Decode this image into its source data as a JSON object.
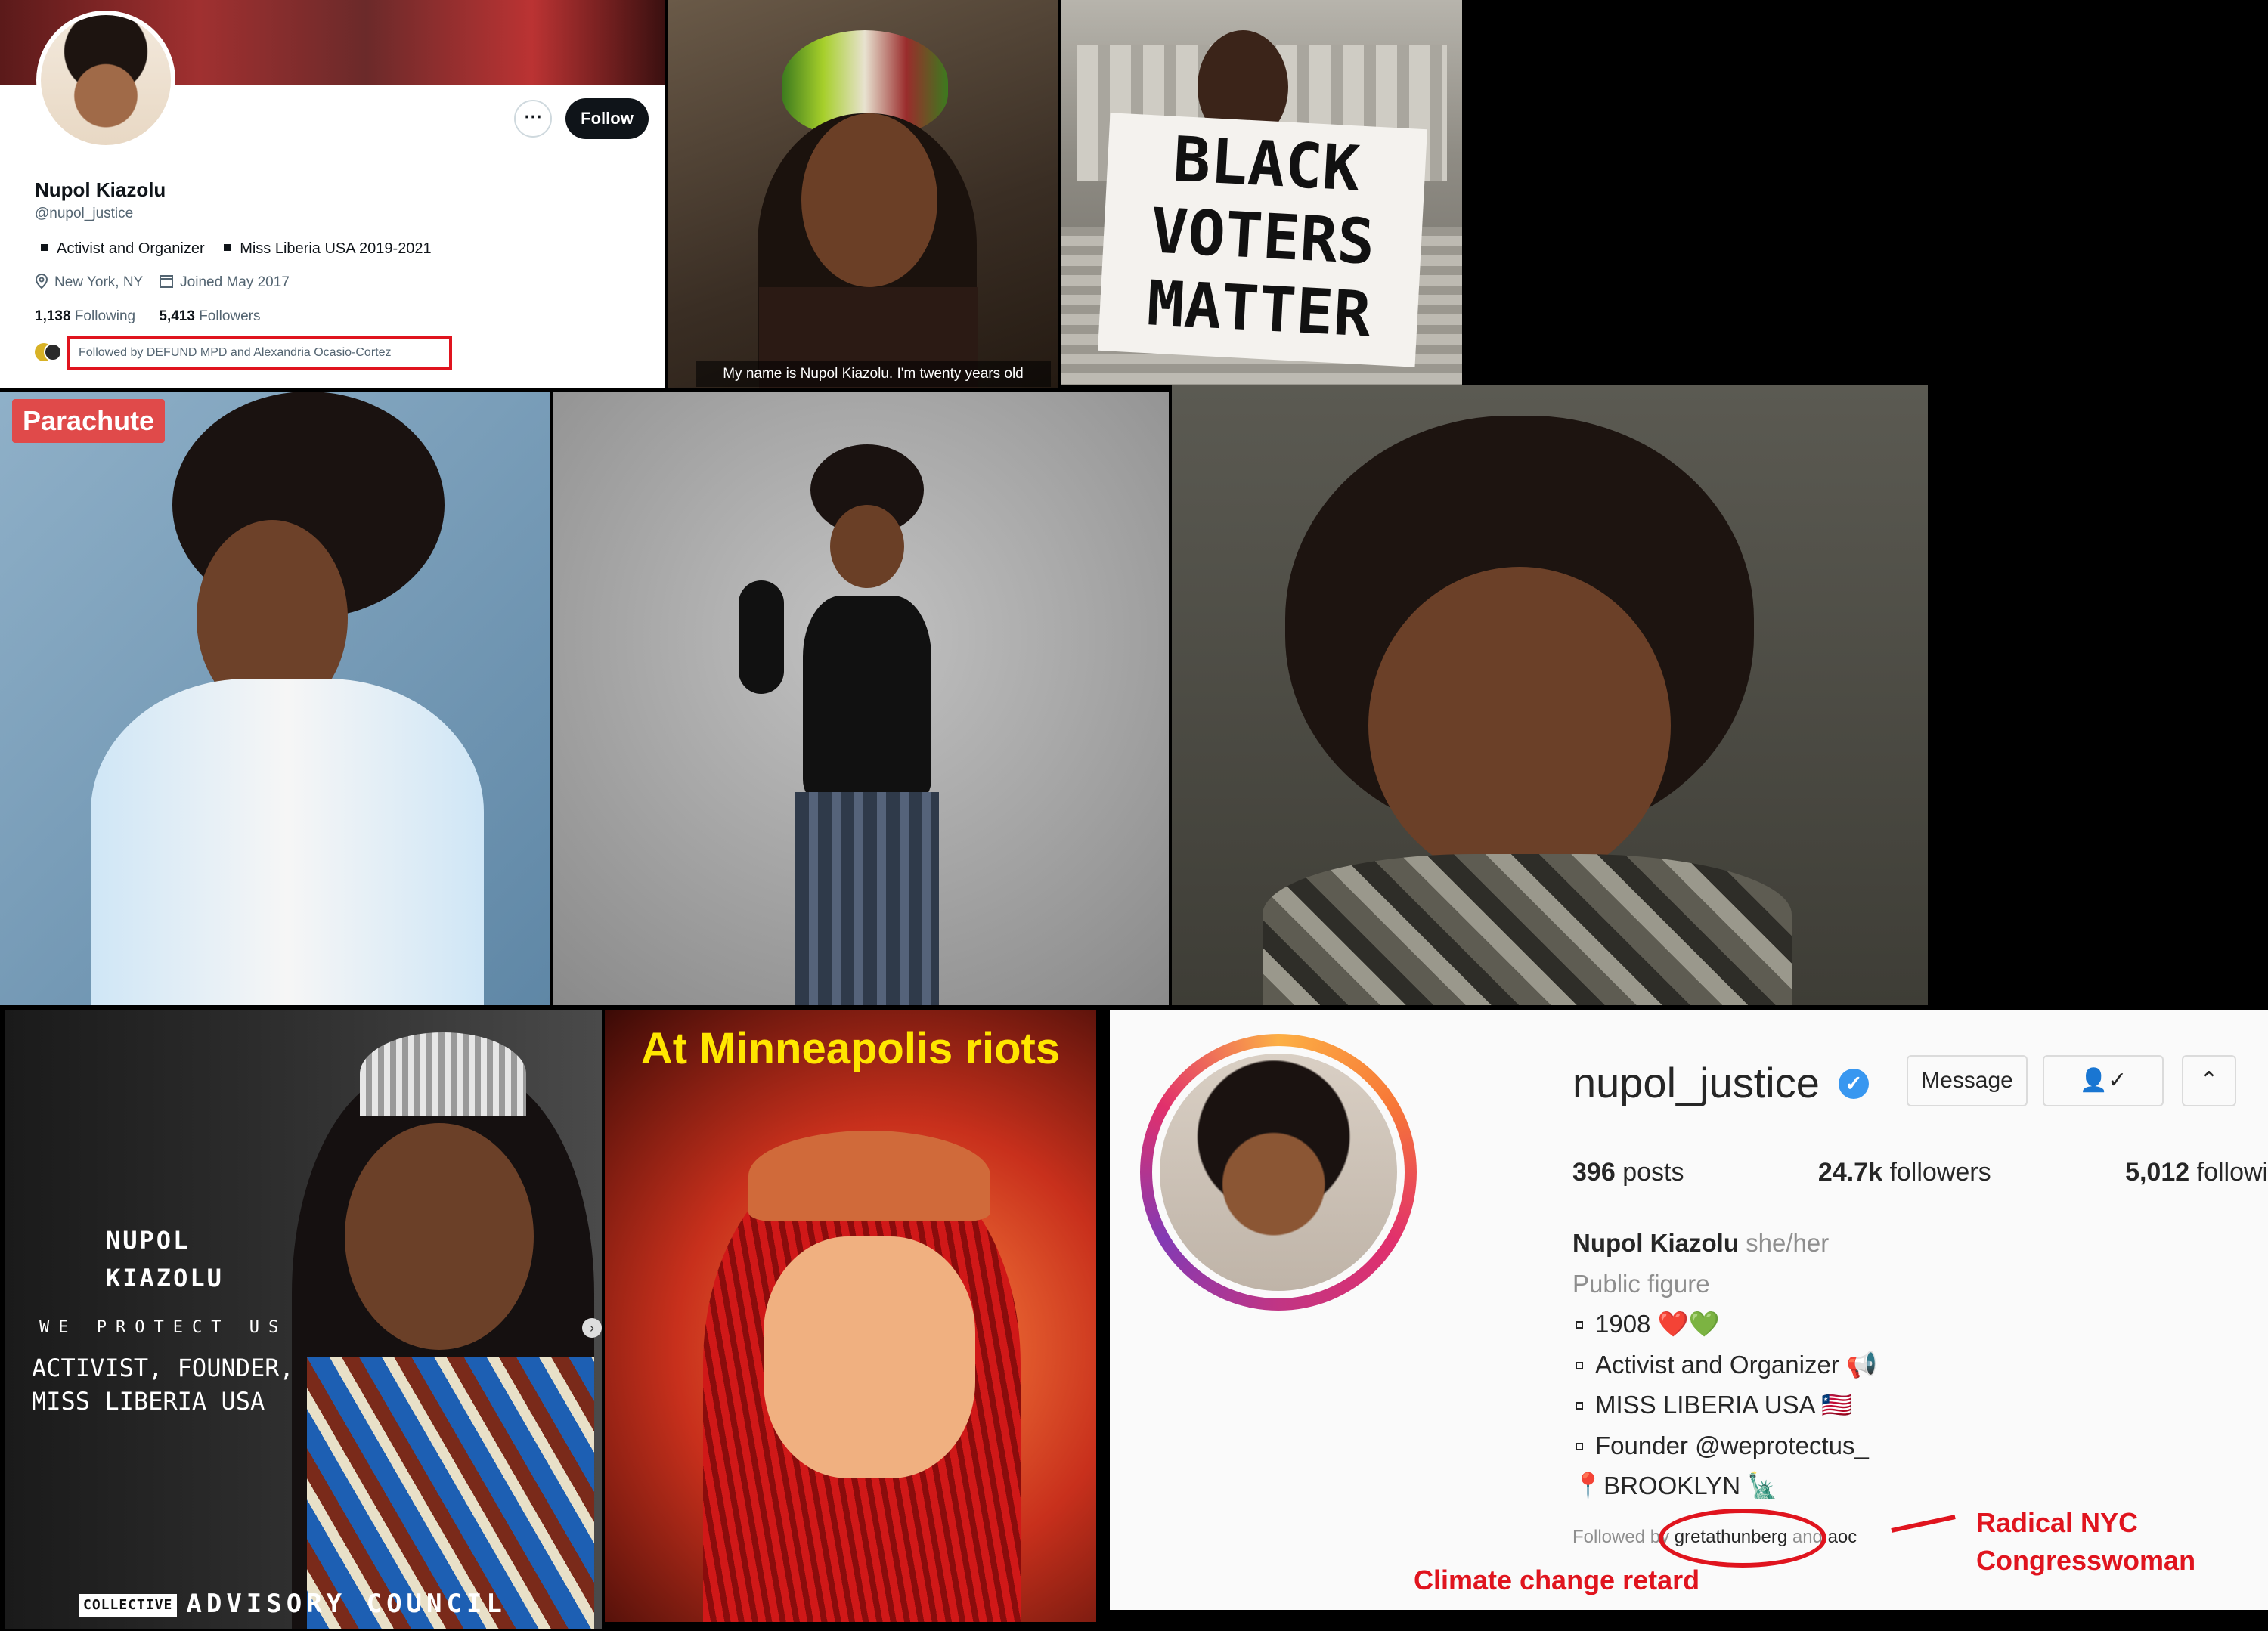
{
  "twitter": {
    "display_name": "Nupol Kiazolu",
    "handle": "@nupol_justice",
    "more_icon": "⋯",
    "follow_label": "Follow",
    "bio_items": [
      "Activist and Organizer",
      "Miss Liberia USA 2019-2021"
    ],
    "location": "New York, NY",
    "joined": "Joined May 2017",
    "following_count": "1,138",
    "following_label": "Following",
    "followers_count": "5,413",
    "followers_label": "Followers",
    "followed_by": "Followed by DEFUND MPD and Alexandria Ocasio-Cortez"
  },
  "video_caption": "My name is Nupol Kiazolu. I'm twenty years old",
  "protest_sign": [
    "BLACK",
    "VOTERS",
    "MATTER"
  ],
  "parachute_logo": "Parachute",
  "collective": {
    "name_lines": [
      "NUPOL",
      "KIAZOLU"
    ],
    "tagline": "WE PROTECT US",
    "role_lines": [
      "ACTIVIST, FOUNDER,",
      "MISS LIBERIA USA"
    ],
    "brand": "COLLECTIVE",
    "footer": "ADVISORY COUNCIL"
  },
  "riots_title": "At Minneapolis riots",
  "instagram": {
    "username": "nupol_justice",
    "verified_icon": "✓",
    "message_label": "Message",
    "follow_icon": "👤✓",
    "chevron_icon": "⌃",
    "posts": "396",
    "posts_label": "posts",
    "followers": "24.7k",
    "followers_label": "followers",
    "following": "5,012",
    "following_label": "following",
    "full_name": "Nupol Kiazolu",
    "pronouns": "she/her",
    "category": "Public figure",
    "bio_lines": [
      "1908 ❤️💚",
      "Activist and Organizer 📢",
      "MISS LIBERIA USA 🇱🇷",
      "Founder @weprotectus_"
    ],
    "location_line": "📍BROOKLYN 🗽",
    "followed_prefix": "Followed by",
    "followed_user1": "gretathunberg",
    "followed_mid": "and",
    "followed_user2": "aoc"
  },
  "annotations": {
    "greta": "Climate change retard",
    "aoc_line1": "Radical NYC",
    "aoc_line2": "Congresswoman"
  },
  "colors": {
    "annotation_red": "#e0141e",
    "riot_yellow": "#ffe600",
    "ig_blue": "#3897f0"
  }
}
